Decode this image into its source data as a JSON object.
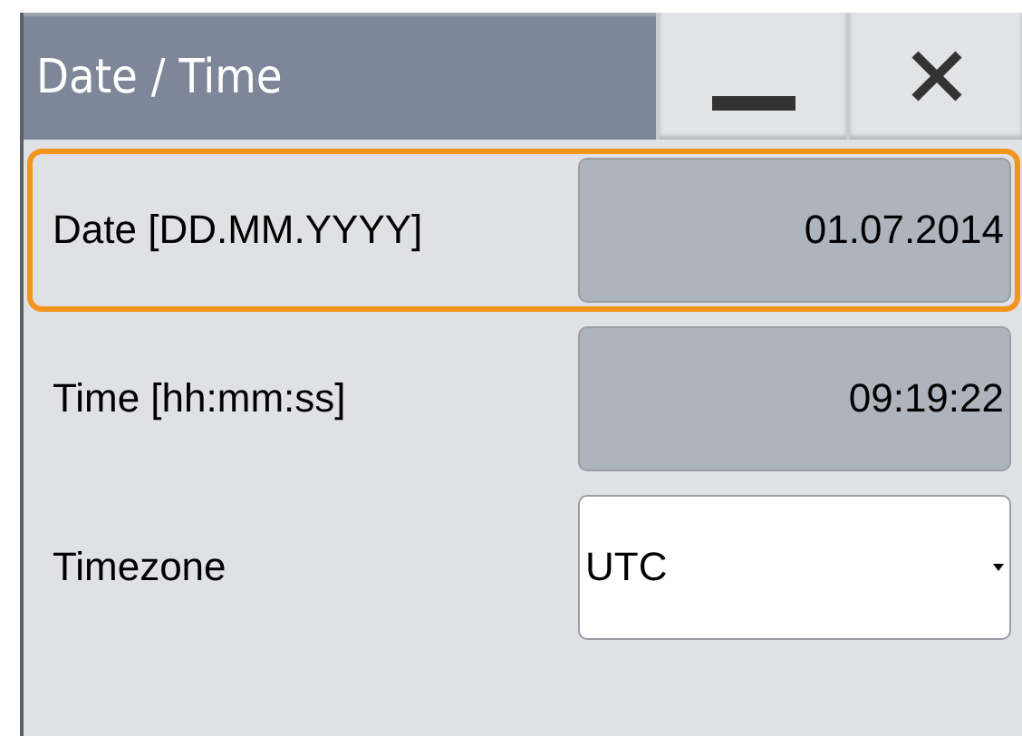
{
  "window": {
    "title": "Date / Time"
  },
  "fields": [
    {
      "label": "Date [DD.MM.YYYY]",
      "value": "01.07.2014",
      "kind": "readonly",
      "focused": true
    },
    {
      "label": "Time [hh:mm:ss]",
      "value": "09:19:22",
      "kind": "readonly",
      "focused": false
    },
    {
      "label": "Timezone",
      "value": "UTC",
      "kind": "dropdown",
      "focused": false
    }
  ]
}
